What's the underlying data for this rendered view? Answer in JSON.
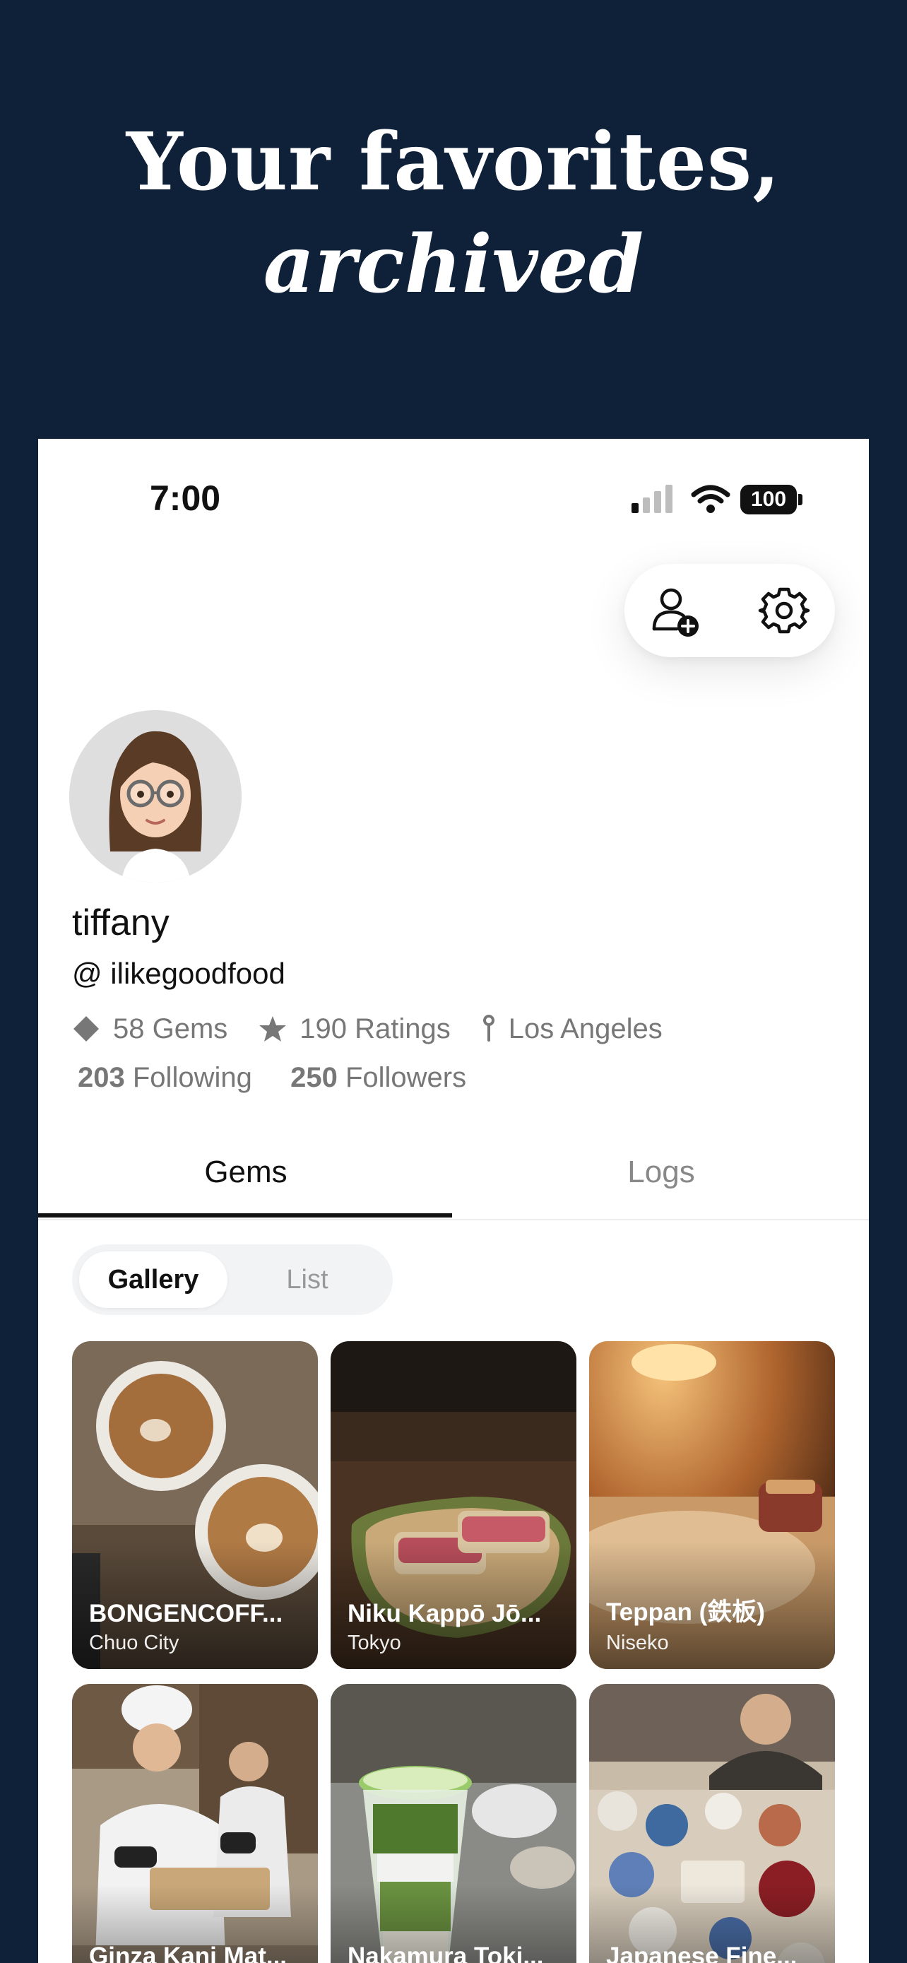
{
  "hero": {
    "line1": "Your favorites,",
    "line2": "archived"
  },
  "status_bar": {
    "time": "7:00",
    "battery": "100"
  },
  "profile": {
    "username": "tiffany",
    "handle": "@ ilikegoodfood",
    "gems": "58 Gems",
    "ratings": "190 Ratings",
    "location": "Los Angeles",
    "following_count": "203",
    "following_label": "Following",
    "followers_count": "250",
    "followers_label": "Followers"
  },
  "tabs": {
    "gems": "Gems",
    "logs": "Logs"
  },
  "view_toggle": {
    "gallery": "Gallery",
    "list": "List"
  },
  "gallery": [
    {
      "name": "BONGENCOFF...",
      "city": "Chuo City"
    },
    {
      "name": "Niku Kappō Jō...",
      "city": "Tokyo"
    },
    {
      "name": "Teppan (鉄板)",
      "city": "Niseko"
    },
    {
      "name": "Ginza Kani Mat...",
      "city": ""
    },
    {
      "name": "Nakamura Toki...",
      "city": ""
    },
    {
      "name": "Japanese Fine...",
      "city": ""
    }
  ],
  "icons": {
    "add_friend": "person-add-icon",
    "settings": "gear-icon",
    "gem": "diamond-icon",
    "rating": "star-icon",
    "location": "pin-icon"
  },
  "colors": {
    "background": "#0f2039",
    "card": "#ffffff",
    "text": "#111111",
    "muted": "#777777"
  }
}
